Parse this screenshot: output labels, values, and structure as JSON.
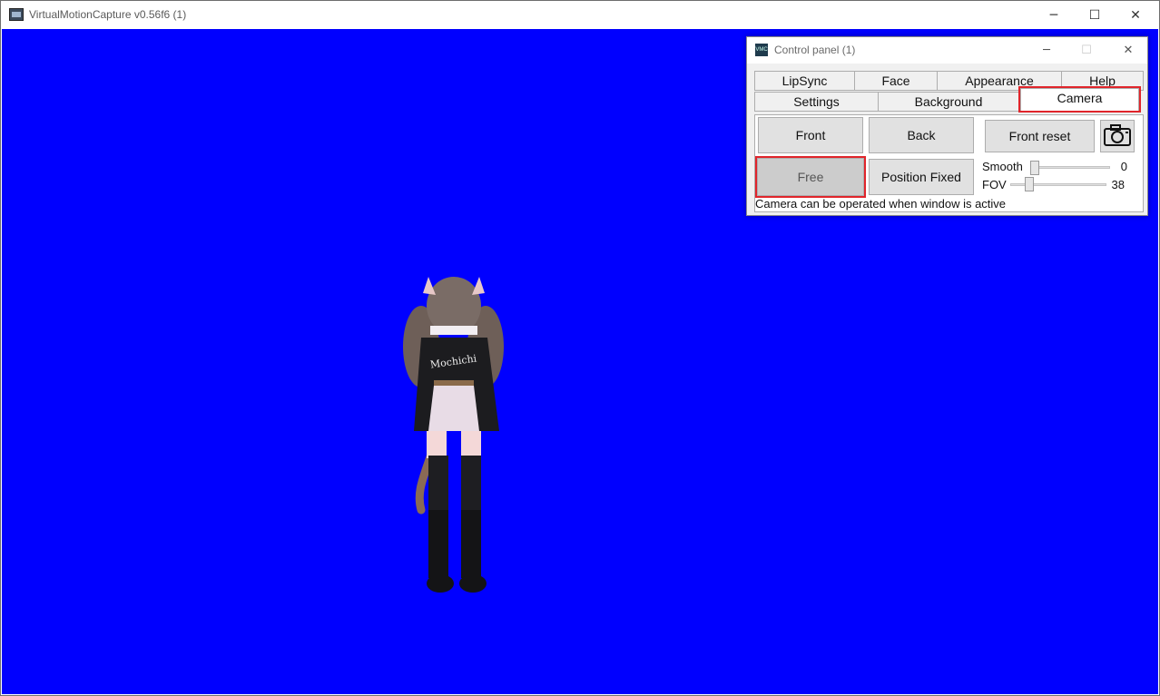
{
  "main_window": {
    "title": "VirtualMotionCapture v0.56f6 (1)",
    "icon": "app-icon",
    "controls": {
      "minimize": "─",
      "maximize": "☐",
      "close": "✕"
    },
    "background_color": "#0000ff"
  },
  "control_panel": {
    "title": "Control panel (1)",
    "icon_text": "VMC",
    "controls": {
      "minimize": "─",
      "maximize": "☐",
      "close": "✕"
    },
    "tabs_row1": [
      "LipSync",
      "Face",
      "Appearance",
      "Help"
    ],
    "tabs_row2": [
      "Settings",
      "Background",
      "Camera"
    ],
    "active_tab": "Camera",
    "camera": {
      "front": "Front",
      "back": "Back",
      "front_reset": "Front reset",
      "free": "Free",
      "position_fixed": "Position Fixed",
      "screenshot_icon": "camera-icon",
      "smooth_label": "Smooth",
      "smooth_value": "0",
      "fov_label": "FOV",
      "fov_value": "38",
      "status": "Camera can be operated when window is active"
    },
    "highlight_color": "#e0252b"
  }
}
